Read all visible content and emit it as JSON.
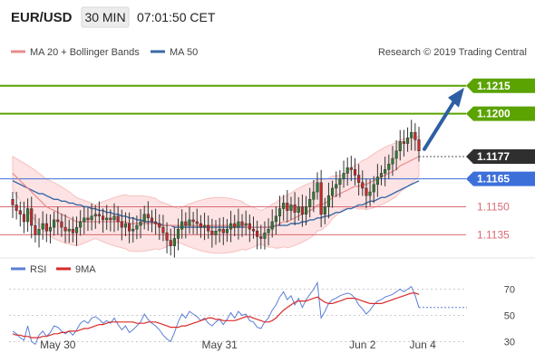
{
  "header": {
    "pair": "EUR/USD",
    "timeframe": "30 MIN",
    "time": "07:01:50 CET"
  },
  "legend": {
    "ma20_label": "MA 20 + Bollinger Bands",
    "ma50_label": "MA 50",
    "credit": "Research © 2019 Trading Central"
  },
  "colors": {
    "up": "#2e7d32",
    "down": "#c62828",
    "ma50": "#3a6aa8",
    "ma20": "#e88b8b",
    "band_fill": "#fde3e3",
    "resistance": "#5aa300",
    "support": "#d96b75",
    "pivot": "#3d6fd9",
    "last": "#333333",
    "rsi": "#5b7fd6",
    "ma9": "#d92b2b"
  },
  "levels": [
    {
      "value": 1.1215,
      "label": "1.1215",
      "kind": "resistance"
    },
    {
      "value": 1.12,
      "label": "1.1200",
      "kind": "resistance"
    },
    {
      "value": 1.1177,
      "label": "1.1177",
      "kind": "last"
    },
    {
      "value": 1.1165,
      "label": "1.1165",
      "kind": "pivot"
    },
    {
      "value": 1.115,
      "label": "1.1150",
      "kind": "support"
    },
    {
      "value": 1.1135,
      "label": "1.1135",
      "kind": "support"
    }
  ],
  "rsi_panel": {
    "rsi_label": "RSI",
    "ma9_label": "9MA",
    "ticks": [
      "70",
      "50",
      "30"
    ]
  },
  "chart_data": {
    "type": "candlestick",
    "y_range": [
      1.1124,
      1.1228
    ],
    "x_labels": [
      {
        "label": "May 30",
        "index": 12
      },
      {
        "label": "May 31",
        "index": 55
      },
      {
        "label": "Jun 2",
        "index": 93
      },
      {
        "label": "Jun 4",
        "index": 109
      }
    ],
    "close": [
      1.1151,
      1.1148,
      1.1146,
      1.1142,
      1.1149,
      1.114,
      1.1135,
      1.1138,
      1.1141,
      1.1137,
      1.1139,
      1.1143,
      1.1142,
      1.1139,
      1.1137,
      1.1138,
      1.1136,
      1.1139,
      1.1142,
      1.1144,
      1.1143,
      1.1145,
      1.1146,
      1.1145,
      1.1143,
      1.1144,
      1.1143,
      1.1145,
      1.1142,
      1.1139,
      1.1141,
      1.1137,
      1.1138,
      1.114,
      1.1142,
      1.1146,
      1.1144,
      1.1142,
      1.1141,
      1.1139,
      1.1136,
      1.1132,
      1.1129,
      1.1133,
      1.1138,
      1.1142,
      1.114,
      1.1143,
      1.1142,
      1.1141,
      1.1139,
      1.114,
      1.1137,
      1.1135,
      1.1137,
      1.1138,
      1.1136,
      1.1138,
      1.1141,
      1.1139,
      1.1142,
      1.114,
      1.1141,
      1.1138,
      1.1137,
      1.1134,
      1.1133,
      1.1136,
      1.1138,
      1.1142,
      1.1145,
      1.1149,
      1.1152,
      1.1148,
      1.1151,
      1.1147,
      1.115,
      1.1146,
      1.115,
      1.1154,
      1.1158,
      1.1163,
      1.1146,
      1.115,
      1.1156,
      1.116,
      1.1162,
      1.1165,
      1.1168,
      1.1171,
      1.117,
      1.1167,
      1.1163,
      1.116,
      1.1156,
      1.1158,
      1.1162,
      1.1166,
      1.1168,
      1.117,
      1.1173,
      1.1176,
      1.118,
      1.1185,
      1.1184,
      1.1187,
      1.119,
      1.1186,
      1.118
    ],
    "ma50": [
      1.1164,
      1.1163,
      1.1162,
      1.1161,
      1.116,
      1.1159,
      1.1158,
      1.1157,
      1.1157,
      1.1156,
      1.1155,
      1.1154,
      1.1154,
      1.1153,
      1.1153,
      1.1152,
      1.1152,
      1.1151,
      1.1151,
      1.115,
      1.115,
      1.1149,
      1.1149,
      1.1148,
      1.1148,
      1.1147,
      1.1147,
      1.1146,
      1.1146,
      1.1145,
      1.1145,
      1.1144,
      1.1144,
      1.1143,
      1.1143,
      1.1142,
      1.1142,
      1.1142,
      1.1141,
      1.1141,
      1.114,
      1.114,
      1.114,
      1.1139,
      1.1139,
      1.1139,
      1.1139,
      1.1139,
      1.1139,
      1.1139,
      1.1139,
      1.1139,
      1.1139,
      1.1139,
      1.1139,
      1.1139,
      1.1139,
      1.1139,
      1.1139,
      1.1139,
      1.1139,
      1.1139,
      1.1139,
      1.1139,
      1.1139,
      1.1139,
      1.1139,
      1.1139,
      1.1139,
      1.1139,
      1.114,
      1.114,
      1.114,
      1.114,
      1.1141,
      1.1141,
      1.1141,
      1.1142,
      1.1142,
      1.1143,
      1.1143,
      1.1144,
      1.1144,
      1.1145,
      1.1145,
      1.1146,
      1.1147,
      1.1147,
      1.1148,
      1.1149,
      1.1149,
      1.115,
      1.1151,
      1.1151,
      1.1152,
      1.1153,
      1.1153,
      1.1154,
      1.1155,
      1.1155,
      1.1156,
      1.1157,
      1.1158,
      1.1159,
      1.116,
      1.1161,
      1.1162,
      1.1163,
      1.1164
    ],
    "ma20": [
      1.1168,
      1.1166,
      1.1164,
      1.1162,
      1.116,
      1.1158,
      1.1156,
      1.1154,
      1.1152,
      1.115,
      1.1149,
      1.1148,
      1.1147,
      1.1146,
      1.1145,
      1.1144,
      1.1143,
      1.1142,
      1.1142,
      1.1142,
      1.1142,
      1.1142,
      1.1142,
      1.1142,
      1.1142,
      1.1142,
      1.1142,
      1.1142,
      1.1142,
      1.1142,
      1.1142,
      1.1141,
      1.1141,
      1.1141,
      1.1141,
      1.1141,
      1.1141,
      1.1141,
      1.1141,
      1.114,
      1.114,
      1.114,
      1.114,
      1.114,
      1.114,
      1.114,
      1.114,
      1.114,
      1.114,
      1.114,
      1.114,
      1.114,
      1.114,
      1.114,
      1.114,
      1.114,
      1.114,
      1.114,
      1.114,
      1.114,
      1.114,
      1.114,
      1.1139,
      1.1139,
      1.1139,
      1.1139,
      1.1139,
      1.1139,
      1.1139,
      1.114,
      1.114,
      1.1141,
      1.1142,
      1.1142,
      1.1143,
      1.1144,
      1.1145,
      1.1146,
      1.1147,
      1.1148,
      1.1149,
      1.1151,
      1.1151,
      1.1152,
      1.1153,
      1.1155,
      1.1156,
      1.1157,
      1.1158,
      1.1159,
      1.116,
      1.1161,
      1.1161,
      1.1162,
      1.1162,
      1.1163,
      1.1164,
      1.1165,
      1.1166,
      1.1167,
      1.1168,
      1.1169,
      1.117,
      1.1172,
      1.1173,
      1.1174,
      1.1175,
      1.1176,
      1.1177
    ],
    "rsi": [
      38,
      36,
      33,
      31,
      42,
      30,
      28,
      35,
      38,
      34,
      37,
      42,
      41,
      38,
      36,
      38,
      35,
      39,
      44,
      46,
      44,
      48,
      49,
      47,
      44,
      46,
      44,
      48,
      43,
      39,
      42,
      37,
      39,
      42,
      45,
      51,
      47,
      44,
      42,
      39,
      35,
      32,
      30,
      37,
      45,
      51,
      48,
      53,
      51,
      49,
      46,
      48,
      44,
      42,
      45,
      47,
      43,
      47,
      52,
      48,
      53,
      50,
      51,
      46,
      45,
      41,
      40,
      45,
      48,
      54,
      58,
      64,
      68,
      62,
      65,
      58,
      63,
      56,
      62,
      66,
      70,
      75,
      48,
      53,
      59,
      62,
      63,
      65,
      66,
      67,
      66,
      63,
      58,
      55,
      51,
      54,
      58,
      61,
      62,
      64,
      65,
      66,
      68,
      70,
      68,
      70,
      72,
      65,
      56
    ],
    "rsi_ma9": [
      36,
      35,
      35,
      34,
      34,
      33,
      33,
      33,
      34,
      34,
      35,
      36,
      36,
      37,
      37,
      38,
      38,
      38,
      39,
      40,
      40,
      41,
      42,
      43,
      43,
      44,
      45,
      45,
      45,
      45,
      45,
      45,
      45,
      44,
      44,
      44,
      45,
      45,
      45,
      44,
      43,
      42,
      41,
      41,
      41,
      42,
      42,
      43,
      44,
      45,
      46,
      47,
      48,
      48,
      47,
      47,
      46,
      46,
      46,
      46,
      47,
      48,
      49,
      49,
      48,
      47,
      46,
      45,
      45,
      46,
      48,
      51,
      54,
      56,
      58,
      60,
      61,
      61,
      61,
      62,
      63,
      64,
      62,
      60,
      59,
      59,
      60,
      61,
      62,
      63,
      63,
      63,
      62,
      61,
      60,
      59,
      59,
      59,
      59,
      60,
      61,
      62,
      63,
      64,
      65,
      66,
      67,
      67,
      66
    ]
  }
}
